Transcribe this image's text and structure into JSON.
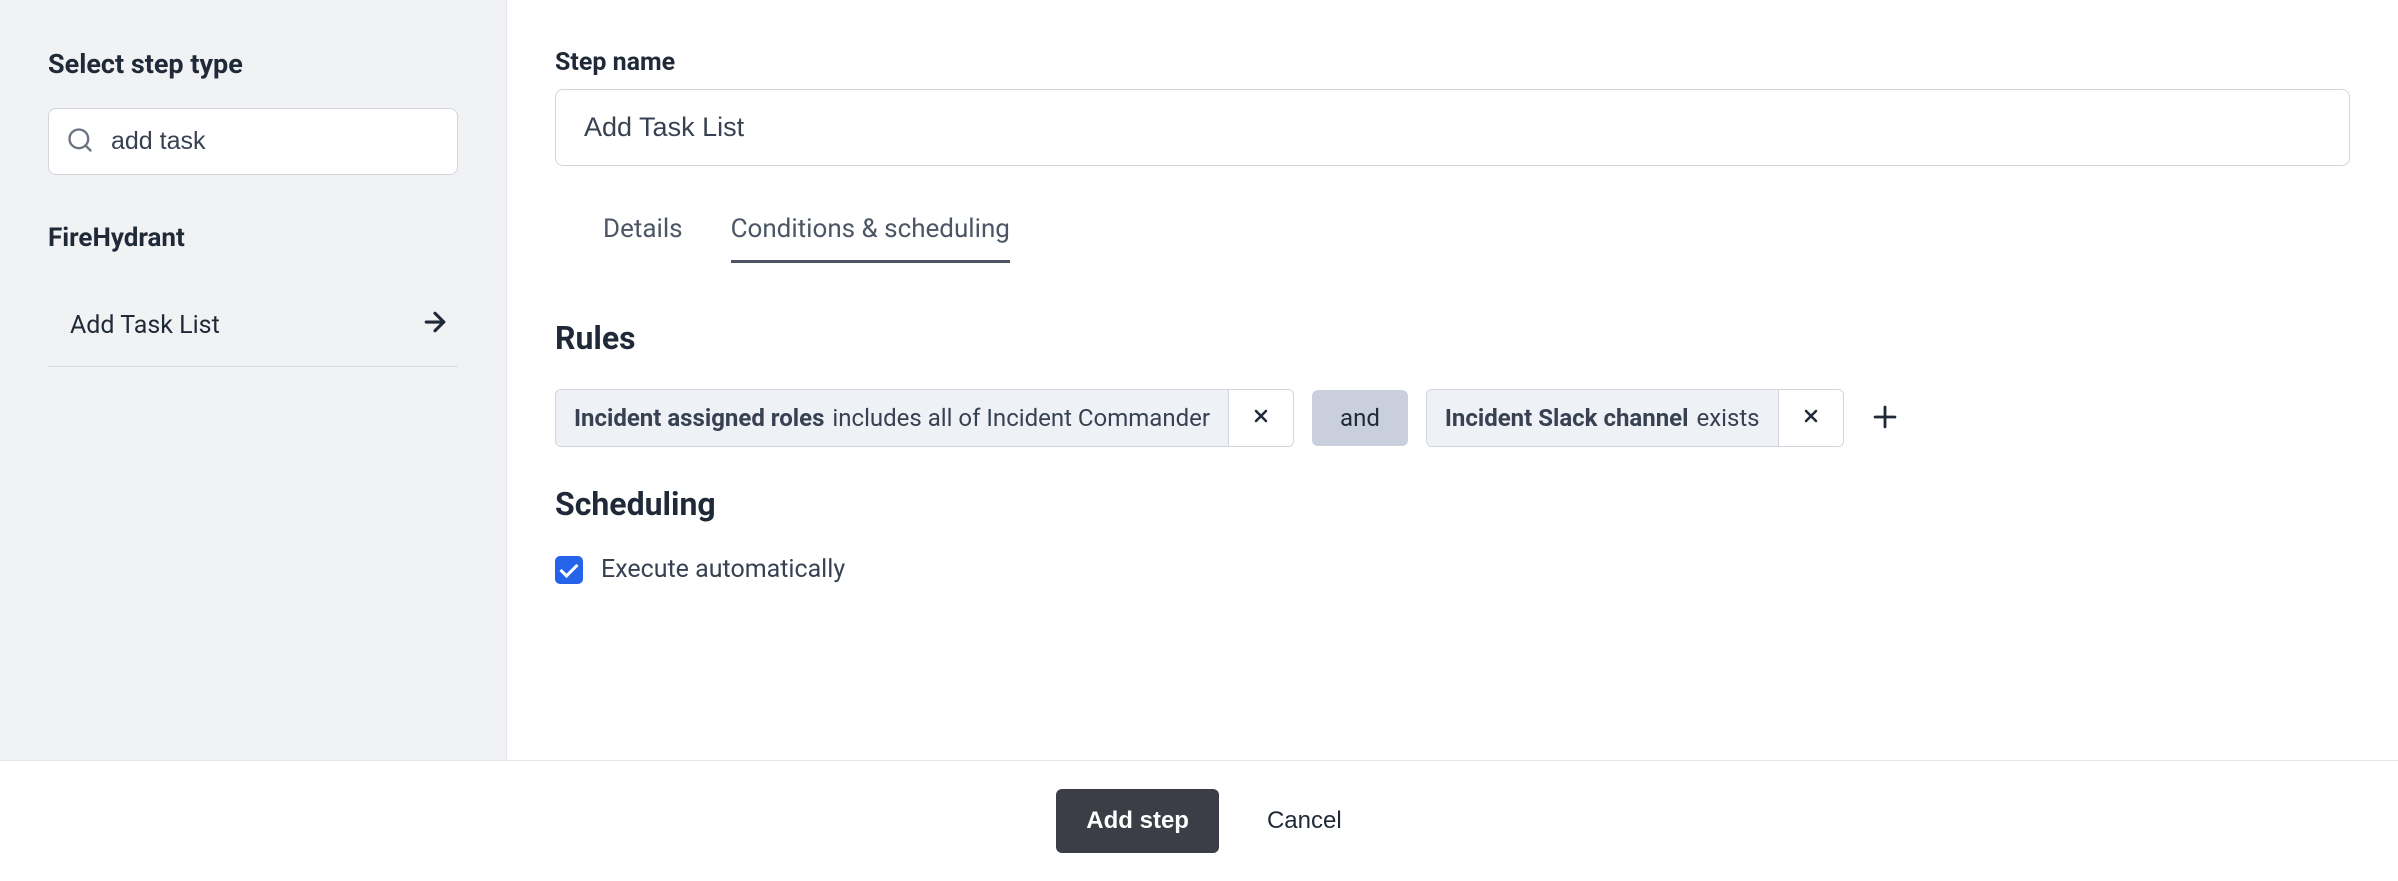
{
  "sidebar": {
    "title": "Select step type",
    "search_value": "add task",
    "section_label": "FireHydrant",
    "items": [
      {
        "label": "Add Task List"
      }
    ]
  },
  "main": {
    "step_name_label": "Step name",
    "step_name_value": "Add Task List",
    "tabs": [
      {
        "label": "Details",
        "active": false
      },
      {
        "label": "Conditions & scheduling",
        "active": true
      }
    ],
    "rules_heading": "Rules",
    "rules": [
      {
        "field": "Incident assigned roles",
        "condition": "includes all of Incident Commander"
      },
      {
        "field": "Incident Slack channel",
        "condition": "exists"
      }
    ],
    "connector": "and",
    "scheduling_heading": "Scheduling",
    "execute_auto_label": "Execute automatically",
    "execute_auto_checked": true
  },
  "footer": {
    "add_step_label": "Add step",
    "cancel_label": "Cancel"
  }
}
